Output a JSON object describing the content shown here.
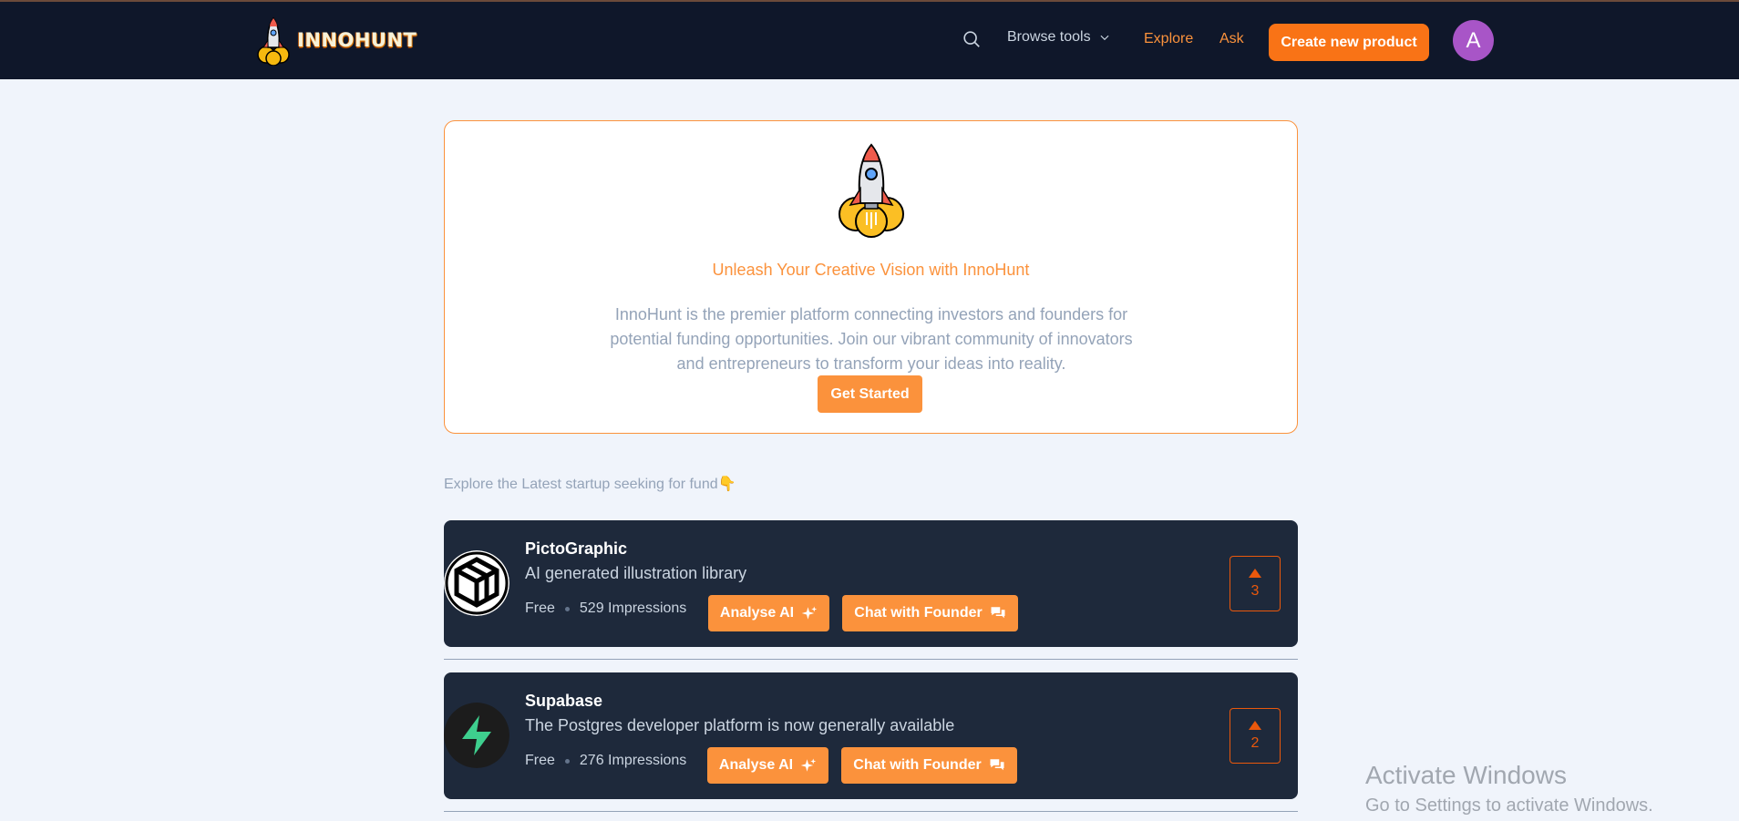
{
  "nav": {
    "brand": "INNOHUNT",
    "browse_label": "Browse tools",
    "explore_label": "Explore",
    "ask_label": "Ask",
    "create_label": "Create new product",
    "avatar_initial": "A"
  },
  "hero": {
    "title": "Unleash Your Creative Vision with InnoHunt",
    "description": "InnoHunt is the premier platform connecting investors and founders for potential funding opportunities. Join our vibrant community of innovators and entrepreneurs to transform your ideas into reality.",
    "cta_label": "Get Started"
  },
  "section_label": "Explore the Latest startup seeking for fund👇",
  "products": [
    {
      "name": "PictoGraphic",
      "tagline": "AI generated illustration library",
      "pricing": "Free",
      "impressions": "529 Impressions",
      "analyse_label": "Analyse AI",
      "chat_label": "Chat with Founder",
      "upvotes": "3"
    },
    {
      "name": "Supabase",
      "tagline": "The Postgres developer platform is now generally available",
      "pricing": "Free",
      "impressions": "276 Impressions",
      "analyse_label": "Analyse AI",
      "chat_label": "Chat with Founder",
      "upvotes": "2"
    }
  ],
  "watermark": {
    "line1": "Activate Windows",
    "line2": "Go to Settings to activate Windows."
  }
}
